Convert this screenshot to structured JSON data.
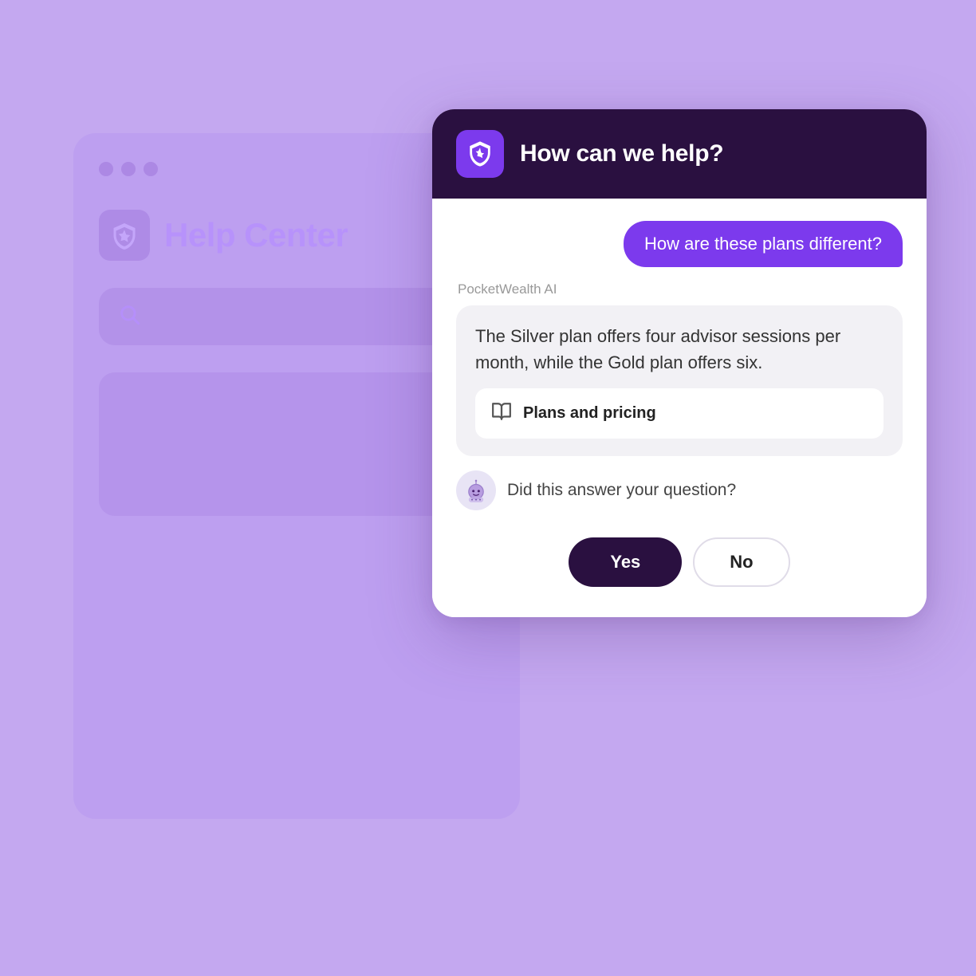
{
  "background": {
    "dots": [
      "dot1",
      "dot2",
      "dot3"
    ],
    "help_center_label": "Help Center"
  },
  "chat_widget": {
    "header": {
      "title": "How can we help?",
      "icon_label": "shield-star-icon"
    },
    "user_message": "How are these plans different?",
    "ai_sender": "PocketWealth AI",
    "ai_response_text": "The Silver plan offers four advisor sessions per month, while the Gold plan offers six.",
    "plans_link_text": "Plans and pricing",
    "bot_question": "Did this answer your question?",
    "yes_button": "Yes",
    "no_button": "No"
  }
}
